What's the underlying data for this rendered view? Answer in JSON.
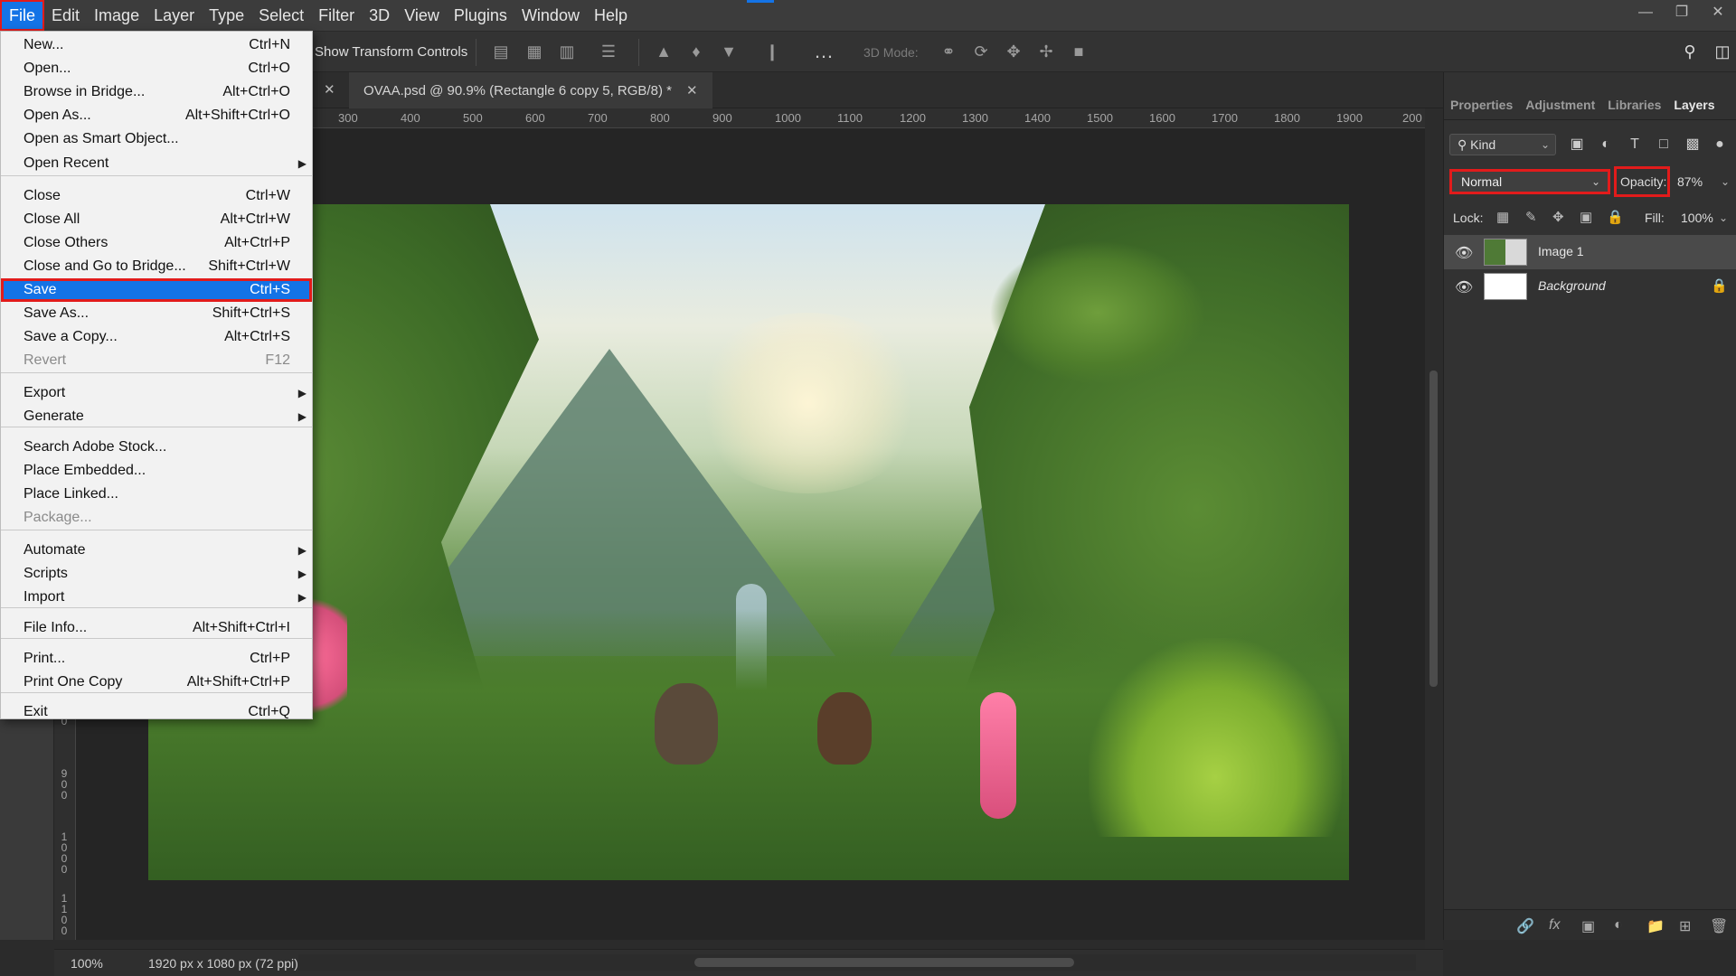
{
  "menubar": [
    "File",
    "Edit",
    "Image",
    "Layer",
    "Type",
    "Select",
    "Filter",
    "3D",
    "View",
    "Plugins",
    "Window",
    "Help"
  ],
  "optbar": {
    "show_transform": "Show Transform Controls",
    "mode_3d": "3D Mode:"
  },
  "doc_tab": {
    "title": "OVAA.psd @ 90.9% (Rectangle 6 copy 5, RGB/8) *"
  },
  "ruler_h": [
    "300",
    "400",
    "500",
    "600",
    "700",
    "800",
    "900",
    "1000",
    "1100",
    "1200",
    "1300",
    "1400",
    "1500",
    "1600",
    "1700",
    "1800",
    "1900",
    "200"
  ],
  "ruler_v": [
    "0",
    "900",
    "1000",
    "1100"
  ],
  "file_menu": [
    {
      "label": "New...",
      "shortcut": "Ctrl+N"
    },
    {
      "label": "Open...",
      "shortcut": "Ctrl+O"
    },
    {
      "label": "Browse in Bridge...",
      "shortcut": "Alt+Ctrl+O"
    },
    {
      "label": "Open As...",
      "shortcut": "Alt+Shift+Ctrl+O"
    },
    {
      "label": "Open as Smart Object...",
      "shortcut": ""
    },
    {
      "label": "Open Recent",
      "shortcut": ""
    },
    {
      "label": "Close",
      "shortcut": "Ctrl+W"
    },
    {
      "label": "Close All",
      "shortcut": "Alt+Ctrl+W"
    },
    {
      "label": "Close Others",
      "shortcut": "Alt+Ctrl+P"
    },
    {
      "label": "Close and Go to Bridge...",
      "shortcut": "Shift+Ctrl+W"
    },
    {
      "label": "Save",
      "shortcut": "Ctrl+S"
    },
    {
      "label": "Save As...",
      "shortcut": "Shift+Ctrl+S"
    },
    {
      "label": "Save a Copy...",
      "shortcut": "Alt+Ctrl+S"
    },
    {
      "label": "Revert",
      "shortcut": "F12"
    },
    {
      "label": "Export",
      "shortcut": ""
    },
    {
      "label": "Generate",
      "shortcut": ""
    },
    {
      "label": "Search Adobe Stock...",
      "shortcut": ""
    },
    {
      "label": "Place Embedded...",
      "shortcut": ""
    },
    {
      "label": "Place Linked...",
      "shortcut": ""
    },
    {
      "label": "Package...",
      "shortcut": ""
    },
    {
      "label": "Automate",
      "shortcut": ""
    },
    {
      "label": "Scripts",
      "shortcut": ""
    },
    {
      "label": "Import",
      "shortcut": ""
    },
    {
      "label": "File Info...",
      "shortcut": "Alt+Shift+Ctrl+I"
    },
    {
      "label": "Print...",
      "shortcut": "Ctrl+P"
    },
    {
      "label": "Print One Copy",
      "shortcut": "Alt+Shift+Ctrl+P"
    },
    {
      "label": "Exit",
      "shortcut": "Ctrl+Q"
    }
  ],
  "panel": {
    "tabs": [
      "Properties",
      "Adjustment",
      "Libraries",
      "Layers"
    ],
    "kind": "Kind",
    "blend_mode": "Normal",
    "opacity_label": "Opacity:",
    "opacity_value": "87%",
    "lock_label": "Lock:",
    "fill_label": "Fill:",
    "fill_value": "100%",
    "layers": [
      {
        "name": "Image 1"
      },
      {
        "name": "Background"
      }
    ]
  },
  "status": {
    "zoom": "100%",
    "doc_size": "1920 px x 1080 px (72 ppi)"
  },
  "colors": {
    "accent": "#1473e6",
    "highlight": "#e21b1b"
  },
  "icons": [
    "search-icon",
    "workspace-icon",
    "align-left-icon",
    "align-center-icon",
    "align-right-icon",
    "distribute-icon",
    "more-icon",
    "orbit-3d-icon",
    "roll-3d-icon",
    "pan-3d-icon",
    "slide-3d-icon",
    "scale-3d-icon",
    "eye-icon",
    "lock-icon",
    "link-icon",
    "fx-icon",
    "mask-icon",
    "adjustment-icon",
    "folder-icon",
    "new-layer-icon",
    "trash-icon"
  ]
}
